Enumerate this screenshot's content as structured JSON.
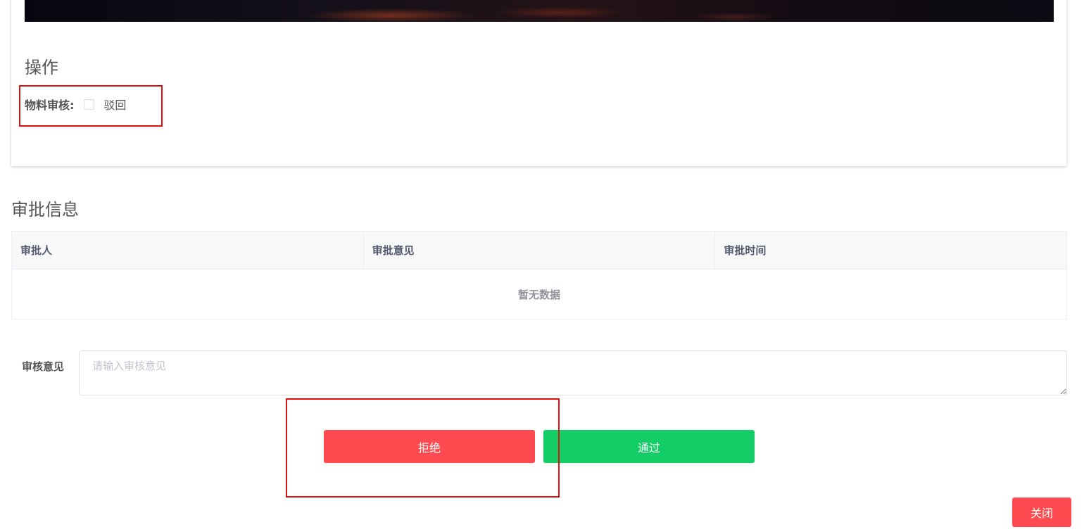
{
  "operations": {
    "title": "操作",
    "material_review": {
      "label": "物料审核:",
      "checkbox_label": "驳回",
      "checked": false
    }
  },
  "approval_info": {
    "title": "审批信息",
    "columns": [
      "审批人",
      "审批意见",
      "审批时间"
    ],
    "empty_text": "暂无数据"
  },
  "review_opinion": {
    "label": "审核意见",
    "placeholder": "请输入审核意见",
    "value": ""
  },
  "actions": {
    "reject_label": "拒绝",
    "pass_label": "通过",
    "close_label": "关闭"
  },
  "colors": {
    "reject": "#ff4a4f",
    "pass": "#13ce66",
    "highlight": "#e01010"
  }
}
